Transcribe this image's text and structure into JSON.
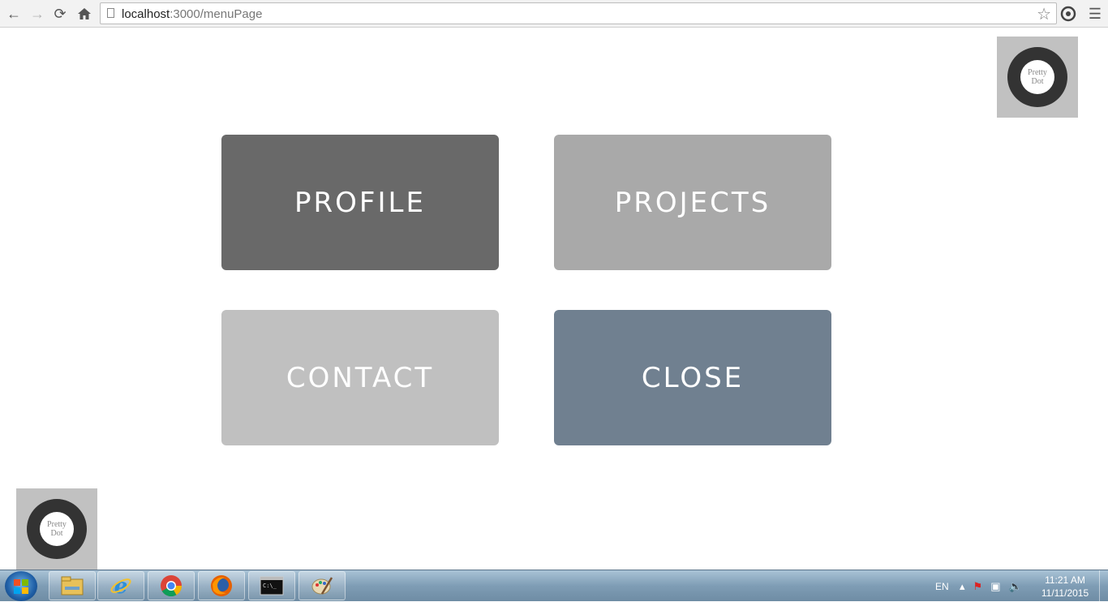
{
  "browser": {
    "url_host": "localhost",
    "url_path": ":3000/menuPage"
  },
  "menu": {
    "tiles": [
      {
        "label": "PROFILE",
        "color": "#696969"
      },
      {
        "label": "PROJECTS",
        "color": "#a9a9a9"
      },
      {
        "label": "CONTACT",
        "color": "#c0c0c0"
      },
      {
        "label": "CLOSE",
        "color": "#708090"
      }
    ]
  },
  "logo": {
    "line1": "Pretty",
    "line2": "Dot",
    "box_color": "#c1c1c1",
    "ring_color": "#333333"
  },
  "taskbar": {
    "apps": [
      "file-explorer-icon",
      "internet-explorer-icon",
      "chrome-icon",
      "firefox-icon",
      "command-prompt-icon",
      "paint-icon"
    ],
    "language": "EN",
    "time": "11:21 AM",
    "date": "11/11/2015"
  }
}
